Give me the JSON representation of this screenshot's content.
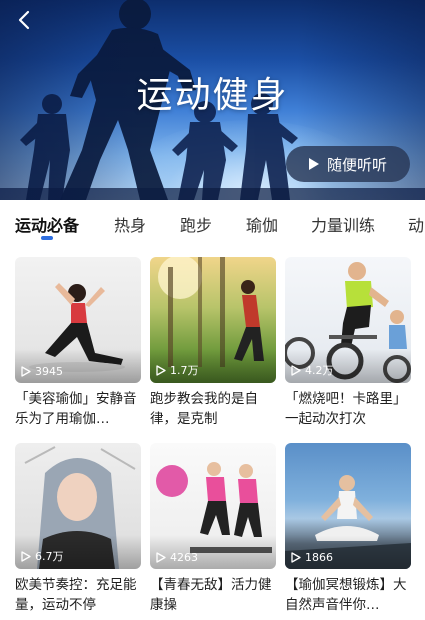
{
  "header": {
    "title": "运动健身",
    "listen_label": "随便听听",
    "back_icon": "chevron-left-icon",
    "play_icon": "play-icon"
  },
  "tabs": [
    {
      "label": "运动必备",
      "active": true
    },
    {
      "label": "热身",
      "active": false
    },
    {
      "label": "跑步",
      "active": false
    },
    {
      "label": "瑜伽",
      "active": false
    },
    {
      "label": "力量训练",
      "active": false
    },
    {
      "label": "动",
      "active": false
    }
  ],
  "accent_color": "#2f6fe0",
  "cards": [
    {
      "plays": "3945",
      "title": "「美容瑜伽」安静音乐为了用瑜伽…"
    },
    {
      "plays": "1.7万",
      "title": "跑步教会我的是自律，是克制"
    },
    {
      "plays": "4.2万",
      "title": "「燃烧吧！卡路里」一起动次打次"
    },
    {
      "plays": "6.7万",
      "title": "欧美节奏控：充足能量，运动不停"
    },
    {
      "plays": "4263",
      "title": "【青春无敌】活力健康操"
    },
    {
      "plays": "1866",
      "title": "【瑜伽冥想锻炼】大自然声音伴你…"
    }
  ]
}
